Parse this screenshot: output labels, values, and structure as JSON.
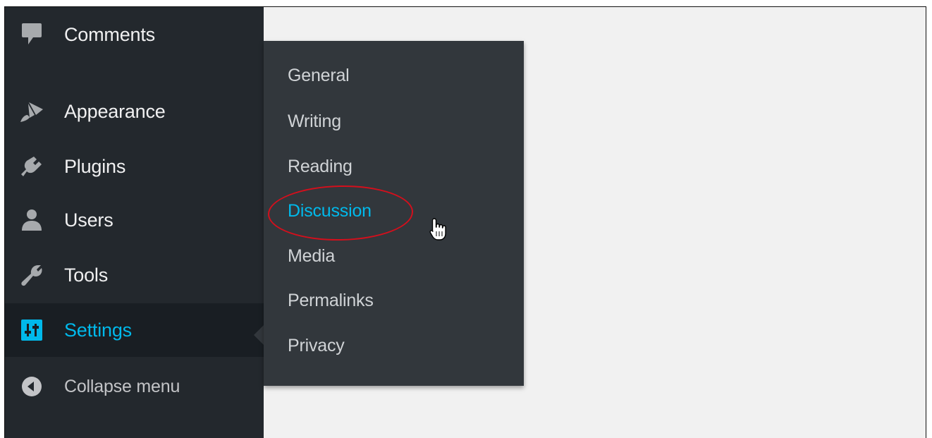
{
  "sidebar": {
    "items": [
      {
        "label": "Comments",
        "icon": "comment-icon"
      },
      {
        "label": "Appearance",
        "icon": "paintbrush-icon"
      },
      {
        "label": "Plugins",
        "icon": "plugin-icon"
      },
      {
        "label": "Users",
        "icon": "user-icon"
      },
      {
        "label": "Tools",
        "icon": "wrench-icon"
      },
      {
        "label": "Settings",
        "icon": "settings-sliders-icon",
        "current": true
      },
      {
        "label": "Collapse menu",
        "icon": "collapse-arrow-icon"
      }
    ]
  },
  "submenu": {
    "items": [
      {
        "label": "General"
      },
      {
        "label": "Writing"
      },
      {
        "label": "Reading"
      },
      {
        "label": "Discussion",
        "active": true
      },
      {
        "label": "Media"
      },
      {
        "label": "Permalinks"
      },
      {
        "label": "Privacy"
      }
    ]
  },
  "colors": {
    "sidebar_bg": "#23282d",
    "submenu_bg": "#32373c",
    "current_item_bg": "#191e23",
    "accent": "#00b9eb",
    "content_bg": "#f1f1f1",
    "annotation": "#d40f1c"
  }
}
